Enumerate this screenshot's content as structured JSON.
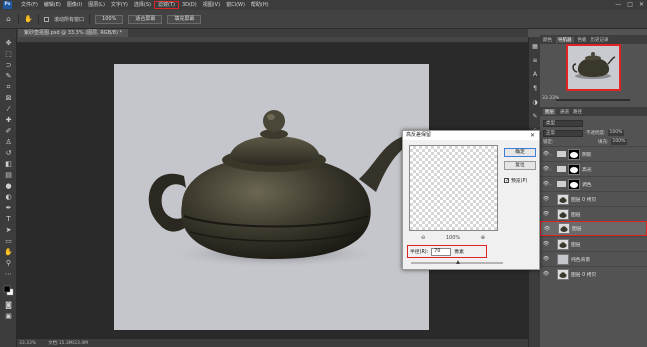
{
  "app": {
    "logo": "Ps"
  },
  "menu": [
    "文件(F)",
    "编辑(E)",
    "图像(I)",
    "图层(L)",
    "文字(Y)",
    "选择(S)",
    "滤镜(T)",
    "3D(D)",
    "视图(V)",
    "窗口(W)",
    "帮助(H)"
  ],
  "menu_highlight_index": 6,
  "window_controls": [
    "—",
    "□",
    "✕"
  ],
  "options": {
    "scroll_all_label": "滚动所有窗口",
    "zoom_value": "100%",
    "fit_screen_label": "适合屏幕",
    "fill_screen_label": "填充屏幕"
  },
  "document": {
    "tab_label": "紫砂壶抠图.psd @ 33.3% (图层, RGB/8) *"
  },
  "status": {
    "zoom": "33.33%",
    "doc_info": "文档:15.3M/23.4M"
  },
  "navigator": {
    "tabs": [
      "颜色",
      "导航器",
      "色板",
      "历史记录"
    ],
    "active_tab": 1,
    "zoom": "33.33%"
  },
  "layers_panel": {
    "tabs": [
      "图层",
      "通道",
      "路径"
    ],
    "kind_label": "类型",
    "blend_mode": "正常",
    "opacity_label": "不透明度:",
    "opacity_value": "100%",
    "lock_label": "锁定:",
    "fill_label": "填充:",
    "fill_value": "100%",
    "layers": [
      {
        "name": "阴影",
        "type": "group",
        "selected": false
      },
      {
        "name": "高光",
        "type": "group",
        "selected": false
      },
      {
        "name": "调色",
        "type": "group",
        "selected": false
      },
      {
        "name": "图层 0 拷贝",
        "type": "layer",
        "selected": false
      },
      {
        "name": "图层",
        "type": "layer",
        "selected": false
      },
      {
        "name": "图层",
        "type": "layer",
        "selected": true
      },
      {
        "name": "图层",
        "type": "layer",
        "selected": false
      },
      {
        "name": "纯色背景",
        "type": "fill",
        "selected": false
      },
      {
        "name": "图层 0 拷贝",
        "type": "layer",
        "selected": false
      }
    ]
  },
  "dialog": {
    "title": "高反差保留",
    "ok_label": "确定",
    "cancel_label": "复位",
    "preview_label": "预览(P)",
    "preview_checked": true,
    "zoom_out": "⊖",
    "zoom_value": "100%",
    "zoom_in": "⊕",
    "radius_label": "半径(R):",
    "radius_value": "70",
    "radius_unit": "像素"
  },
  "colors": {
    "highlight": "#e02424",
    "canvas_bg": "#c4c6cb"
  }
}
